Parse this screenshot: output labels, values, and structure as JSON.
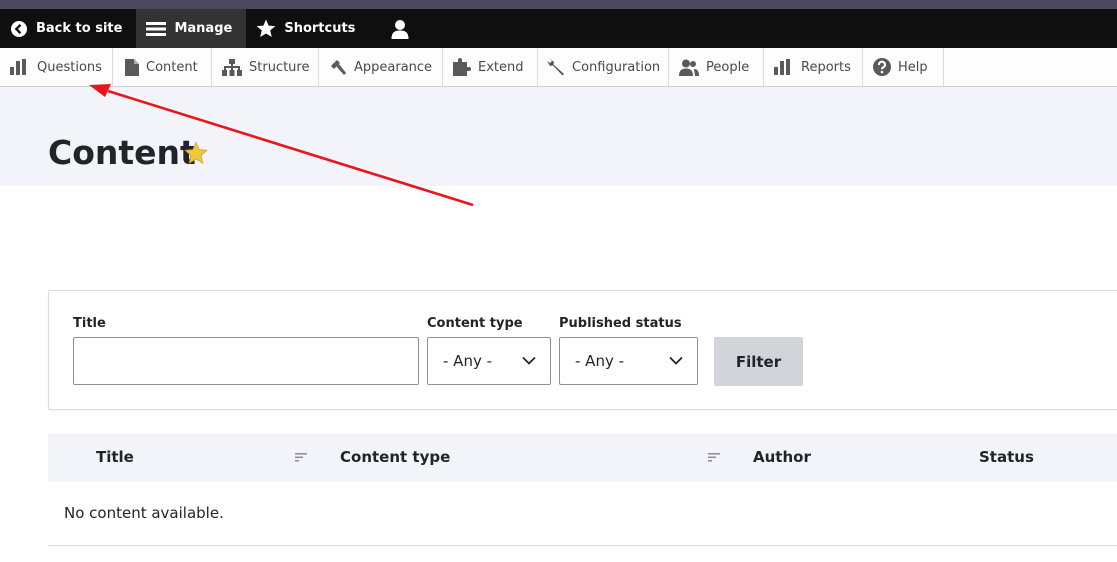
{
  "toolbar": {
    "back_to_site": "Back to site",
    "manage": "Manage",
    "shortcuts": "Shortcuts"
  },
  "tray": {
    "items": [
      {
        "label": "Questions",
        "icon": "bar-chart-icon"
      },
      {
        "label": "Content",
        "icon": "document-icon"
      },
      {
        "label": "Structure",
        "icon": "sitemap-icon"
      },
      {
        "label": "Appearance",
        "icon": "brush-icon"
      },
      {
        "label": "Extend",
        "icon": "puzzle-icon"
      },
      {
        "label": "Configuration",
        "icon": "wrench-icon"
      },
      {
        "label": "People",
        "icon": "people-icon"
      },
      {
        "label": "Reports",
        "icon": "bar-chart-icon"
      },
      {
        "label": "Help",
        "icon": "help-icon"
      }
    ]
  },
  "page": {
    "title": "Content"
  },
  "filters": {
    "title_label": "Title",
    "title_value": "",
    "content_type_label": "Content type",
    "content_type_value": "- Any -",
    "published_status_label": "Published status",
    "published_status_value": "- Any -",
    "filter_button": "Filter"
  },
  "table": {
    "columns": [
      "Title",
      "Content type",
      "Author",
      "Status"
    ],
    "empty_message": "No content available."
  },
  "colors": {
    "toolbar_bg": "#0f0f0f",
    "page_header_bg": "#f3f4f9",
    "annotation_arrow": "#e8151b",
    "star": "#f0c93a"
  }
}
